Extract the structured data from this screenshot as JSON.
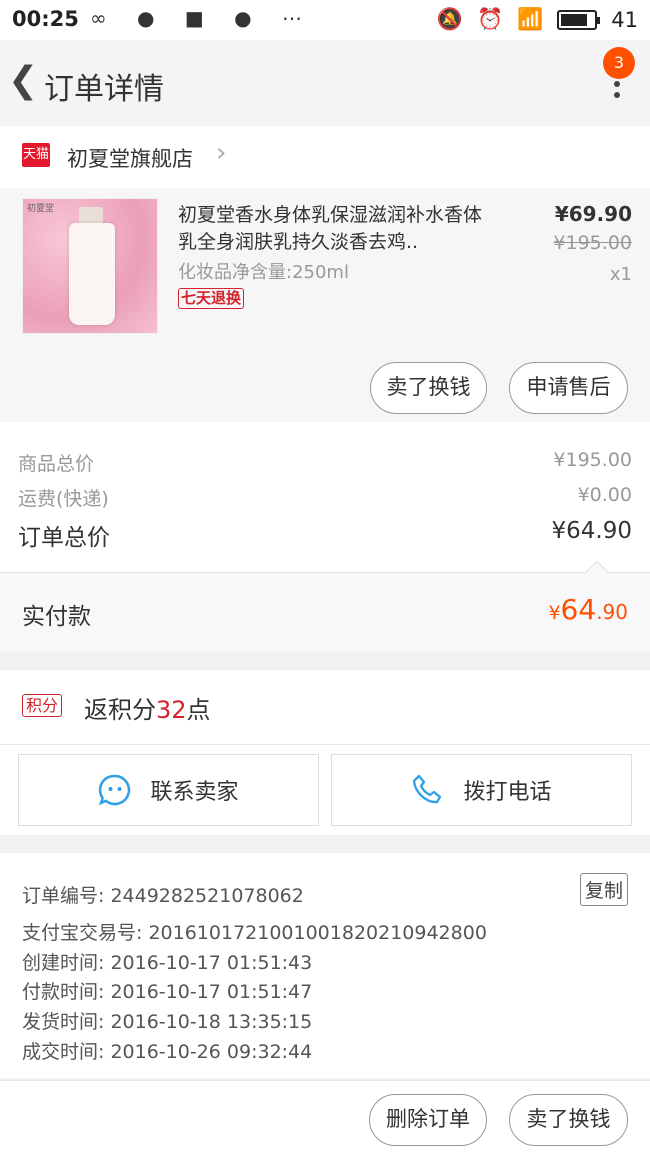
{
  "status_bar": {
    "time": "00:25",
    "battery": "41"
  },
  "header": {
    "title": "订单详情",
    "badge_count": "3"
  },
  "store": {
    "badge": "天猫",
    "name": "初夏堂旗舰店"
  },
  "product": {
    "title": "初夏堂香水身体乳保湿滋润补水香体乳全身润肤乳持久淡香去鸡..",
    "spec": "化妆品净含量:250ml",
    "return_tag": "七天退换",
    "price": "¥69.90",
    "original_price": "¥195.00",
    "quantity": "x1",
    "image_brand": "初夏堂"
  },
  "item_actions": {
    "sell": "卖了换钱",
    "after_sales": "申请售后"
  },
  "summary": {
    "goods_label": "商品总价",
    "goods_value": "¥195.00",
    "shipping_label": "运费(快递)",
    "shipping_value": "¥0.00",
    "total_label": "订单总价",
    "total_value": "¥64.90"
  },
  "paid": {
    "label": "实付款",
    "currency": "¥",
    "integer": "64",
    "decimal": ".90"
  },
  "points": {
    "tag": "积分",
    "prefix": "返积分",
    "value": "32",
    "suffix": "点"
  },
  "contact": {
    "seller": "联系卖家",
    "call": "拨打电话"
  },
  "order_info": {
    "order_no": "订单编号: 2449282521078062",
    "alipay_no": "支付宝交易号: 2016101721001001820210942800",
    "created": "创建时间: 2016-10-17 01:51:43",
    "paid": "付款时间: 2016-10-17 01:51:47",
    "shipped": "发货时间: 2016-10-18 13:35:15",
    "completed": "成交时间: 2016-10-26 09:32:44",
    "copy": "复制"
  },
  "bottom_actions": {
    "delete": "删除订单",
    "sell": "卖了换钱"
  },
  "colors": {
    "accent": "#ff5000",
    "tmall_red": "#e4182d",
    "icon_blue": "#2fa0e6"
  }
}
